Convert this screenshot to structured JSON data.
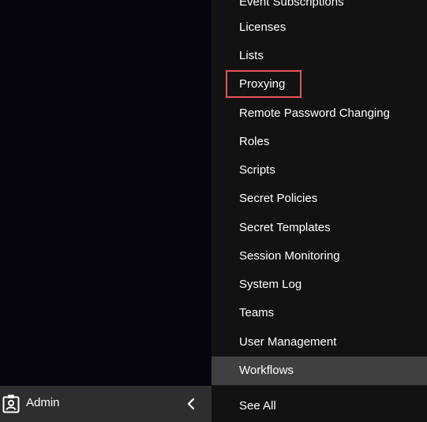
{
  "sidebar": {
    "user_label": "Admin",
    "user_icon": "admin-badge-icon",
    "collapse_icon": "chevron-left-icon"
  },
  "menu": {
    "items": [
      {
        "label": "Event Subscriptions"
      },
      {
        "label": "Licenses"
      },
      {
        "label": "Lists"
      },
      {
        "label": "Proxying"
      },
      {
        "label": "Remote Password Changing"
      },
      {
        "label": "Roles"
      },
      {
        "label": "Scripts"
      },
      {
        "label": "Secret Policies"
      },
      {
        "label": "Secret Templates"
      },
      {
        "label": "Session Monitoring"
      },
      {
        "label": "System Log"
      },
      {
        "label": "Teams"
      },
      {
        "label": "User Management"
      },
      {
        "label": "Workflows"
      }
    ],
    "highlighted_item": "Proxying",
    "active_item": "Workflows",
    "see_all_label": "See All"
  },
  "colors": {
    "background": "#050510",
    "menu_background": "#121212",
    "active_background": "#404040",
    "footer_background": "#2e2e2e",
    "highlight_border": "#e0535a",
    "text": "#ffffff"
  }
}
